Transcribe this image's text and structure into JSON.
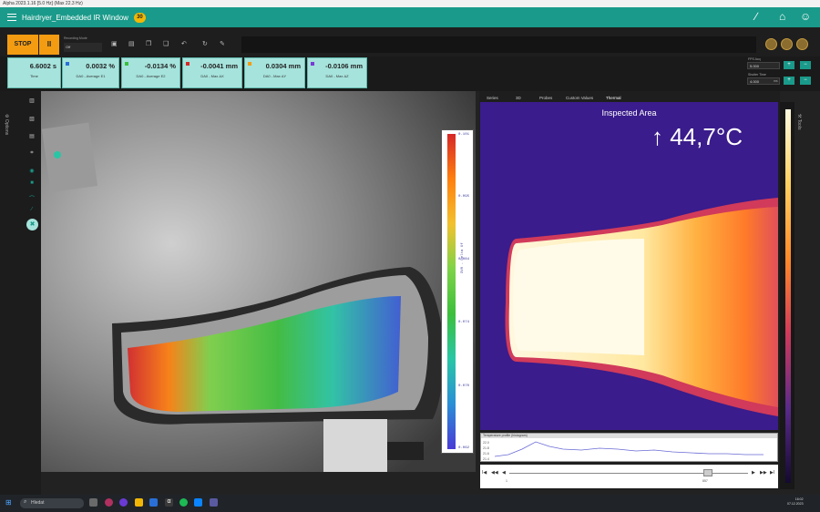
{
  "window_title": "Alpha 2023.1.16 [5.0 Hz] (Max 22.3 Hz)",
  "app": {
    "title": "Hairdryer_Embedded IR Window",
    "badge": "30"
  },
  "toolbar": {
    "stop_label": "STOP",
    "pause_label": "II",
    "recording_mode_label": "Recording Mode",
    "recording_mode_value": "Off"
  },
  "stats": [
    {
      "value": "6.6002 s",
      "label": "Time",
      "color": ""
    },
    {
      "value": "0.0032 %",
      "label": "DA0 - Average E1",
      "color": "#2a6fd6"
    },
    {
      "value": "-0.0134 %",
      "label": "DA0 - Average E2",
      "color": "#3cbf3c"
    },
    {
      "value": "-0.0041 mm",
      "label": "DA0 - Max ΔX",
      "color": "#d62728"
    },
    {
      "value": "0.0304 mm",
      "label": "DA0 - Max ΔY",
      "color": "#f39c12"
    },
    {
      "value": "-0.0106 mm",
      "label": "DA0 - Max ΔZ",
      "color": "#7a3ad6"
    }
  ],
  "right_params": {
    "fps_label": "FPS Acq",
    "fps_value": "5.000",
    "shutter_label": "Shutter Time",
    "shutter_value": "4.000",
    "shutter_unit": "ms",
    "plus": "+",
    "minus": "−"
  },
  "sidebar": {
    "options_label": "Options",
    "tools_label": "Tools"
  },
  "tabs": [
    "Series",
    "3D",
    "Probes",
    "Custom Values",
    "Thermal"
  ],
  "active_tab": "Thermal",
  "thermal": {
    "heading": "Inspected Area",
    "max_temp": "↑ 44,7°C"
  },
  "dvc_legend": {
    "title": "DV0 - Delta Xf",
    "ticks": [
      "0.101",
      "0.095",
      "0.084",
      "0.074",
      "0.070",
      "0.062"
    ]
  },
  "graph": {
    "title": "Temperature profile (histogram)",
    "yticks": [
      "22.0",
      "21.8",
      "21.6",
      "21.4"
    ]
  },
  "timeline": {
    "start": "1",
    "current": "857",
    "buttons": [
      "I◀",
      "◀◀",
      "◀",
      "▶",
      "▶▶",
      "▶I"
    ]
  },
  "taskbar": {
    "search_placeholder": "Hledat",
    "time": "16:02",
    "date": "07.12.2023"
  },
  "colors": {
    "teal": "#1a9a8a",
    "orange": "#f39c12",
    "stat_bg": "#a6e3dc"
  }
}
